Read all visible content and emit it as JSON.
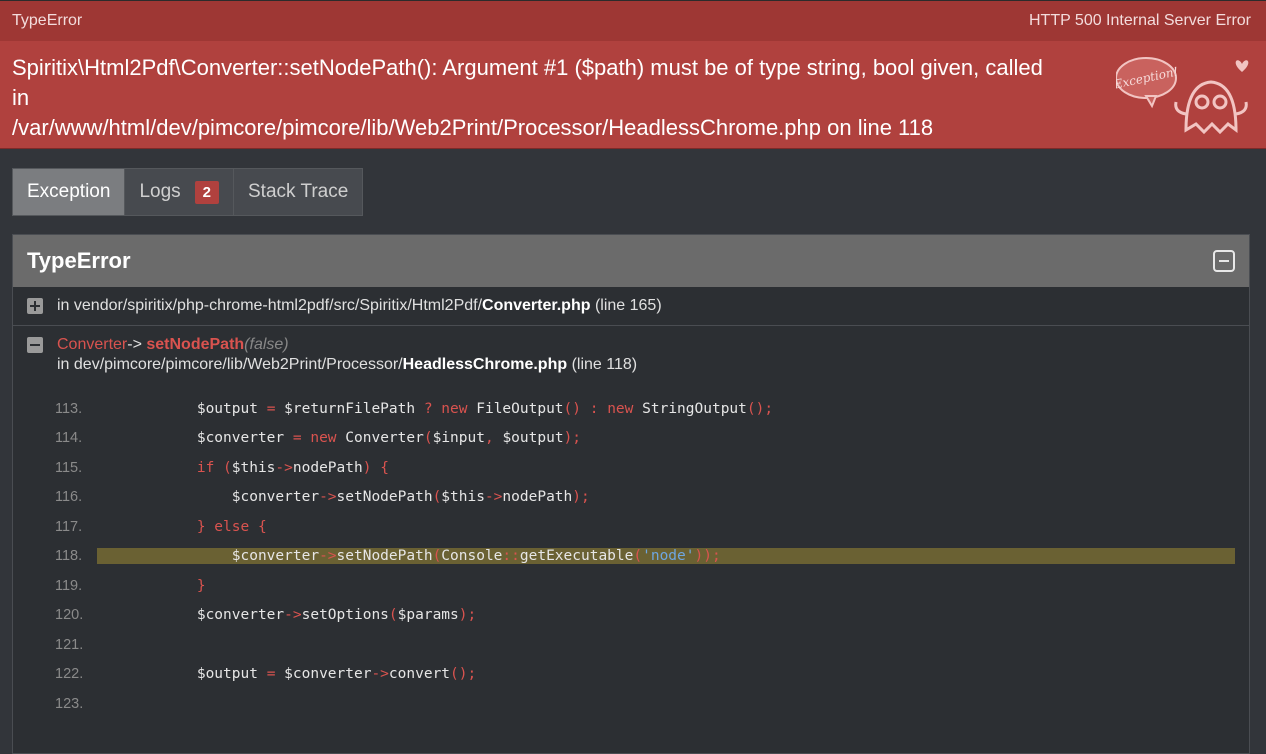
{
  "header": {
    "error_type": "TypeError",
    "status": "HTTP 500 Internal Server Error",
    "message_line1": "Spiritix\\Html2Pdf\\Converter::setNodePath(): Argument #1 ($path) must be of type string, bool given, called in",
    "message_line2": "/var/www/html/dev/pimcore/pimcore/lib/Web2Print/Processor/HeadlessChrome.php on line 118",
    "ghost_text": "Exception!"
  },
  "tabs": [
    {
      "label": "Exception",
      "active": true
    },
    {
      "label": "Logs",
      "badge": "2"
    },
    {
      "label": "Stack Trace"
    }
  ],
  "panel": {
    "title": "TypeError",
    "frame1": {
      "prefix": "in vendor/spiritix/php-chrome-html2pdf/src/Spiritix/Html2Pdf/",
      "file": "Converter.php",
      "line": "(line 165)"
    },
    "frame2": {
      "class": "Converter",
      "arrow": "->",
      "method": "setNodePath",
      "args": "(false)",
      "prefix": "in dev/pimcore/pimcore/lib/Web2Print/Processor/",
      "file": "HeadlessChrome.php",
      "line": "(line 118)"
    },
    "code_lines": [
      {
        "no": "113."
      },
      {
        "no": "114."
      },
      {
        "no": "115."
      },
      {
        "no": "116."
      },
      {
        "no": "117."
      },
      {
        "no": "118."
      },
      {
        "no": "119."
      },
      {
        "no": "120."
      },
      {
        "no": "121."
      },
      {
        "no": "122."
      },
      {
        "no": "123."
      }
    ]
  },
  "colors": {
    "header_bg": "#b0413e",
    "highlight_bg": "#6a6133",
    "keyword": "#d9534f",
    "string": "#6ea6e0"
  }
}
